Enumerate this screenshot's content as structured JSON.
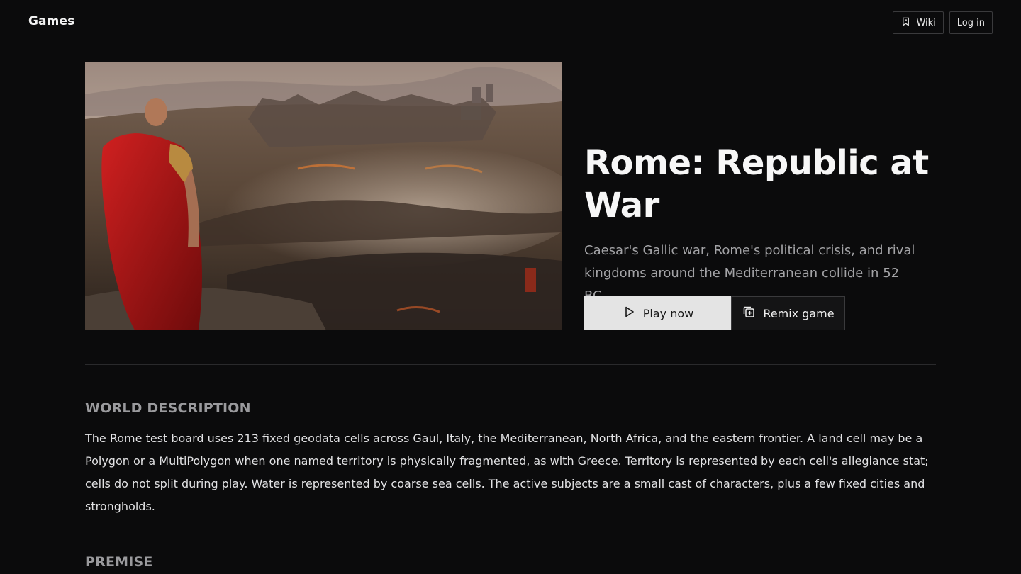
{
  "header": {
    "brand": "Games",
    "wiki_label": "Wiki",
    "login_label": "Log in"
  },
  "hero": {
    "image_alt": "Roman general in red cloak overlooking a battlefield",
    "title": "Rome: Republic at War",
    "subtitle": "Caesar's Gallic war, Rome's political crisis, and rival kingdoms around the Mediterranean collide in 52 BC.",
    "play_label": "Play now",
    "remix_label": "Remix game"
  },
  "sections": {
    "world": {
      "heading": "WORLD DESCRIPTION",
      "text": "The Rome test board uses 213 fixed geodata cells across Gaul, Italy, the Mediterranean, North Africa, and the eastern frontier. A land cell may be a Polygon or a MultiPolygon when one named territory is physically fragmented, as with Greece. Territory is represented by each cell's allegiance stat; cells do not split during play. Water is represented by coarse sea cells. The active subjects are a small cast of characters, plus a few fixed cities and strongholds."
    },
    "premise": {
      "heading": "PREMISE"
    }
  },
  "icons": {
    "wiki": "book-icon",
    "play": "play-icon",
    "remix": "remix-icon"
  },
  "colors": {
    "background": "#0b0b0c",
    "play_button": "#e4e4e4",
    "cloak_red": "#b01818"
  }
}
